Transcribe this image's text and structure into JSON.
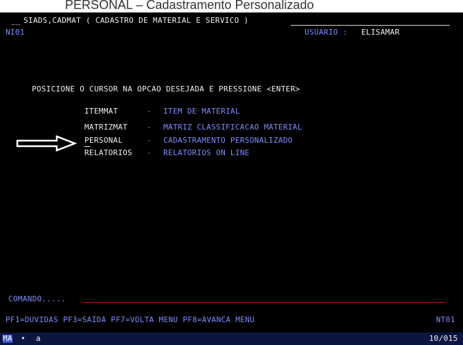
{
  "page_heading": "PERSONAL – Cadastramento Personalizado",
  "terminal": {
    "title_prefix": "__",
    "title": "SIADS,CADMAT ( CADASTRO DE MATERIAL E SERVICO )",
    "screen_id": "NI01",
    "user_label": "USUARIO :",
    "user_name": "ELISAMAR",
    "instruction": "POSICIONE O CURSOR NA OPCAO DESEJADA E PRESSIONE <ENTER>",
    "menu": [
      {
        "code": "ITEMMAT",
        "sep": "-",
        "desc": "ITEM DE MATERIAL"
      },
      {
        "code": "MATRIZMAT",
        "sep": "-",
        "desc": "MATRIZ CLASSIFICACAO MATERIAL"
      },
      {
        "code": "PERSONAL",
        "sep": "-",
        "desc": "CADASTRAMENTO PERSONALIZADO"
      },
      {
        "code": "RELATORIOS",
        "sep": "-",
        "desc": "RELATORIOS ON LINE"
      }
    ],
    "command_label": "COMANDO.....",
    "pf_keys": "PF1=DUVIDAS PF3=SAIDA PF7=VOLTA MENU PF8=AVANCA MENU",
    "screen_code": "NT01",
    "status": {
      "mode": "MA",
      "indicator": "•",
      "session": "a",
      "cursor_pos": "10/015"
    }
  },
  "colors": {
    "background": "#000000",
    "text_white": "#f2f2f2",
    "text_blue": "#7f8cff",
    "command_line": "#c01818",
    "statusbar": "#0b1540"
  },
  "icons": {
    "pointer_arrow": "right-arrow-outline-icon"
  }
}
